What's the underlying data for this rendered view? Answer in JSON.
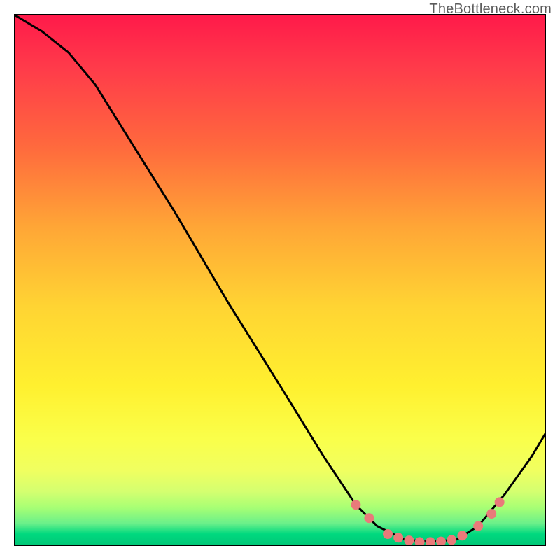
{
  "attribution": "TheBottleneck.com",
  "chart_data": {
    "type": "line",
    "title": "",
    "xlabel": "",
    "ylabel": "",
    "x_range": [
      0,
      1
    ],
    "y_range": [
      0,
      1
    ],
    "background_gradient": {
      "top": "#ff1a4a",
      "mid_high": "#ffd433",
      "mid_low": "#fff02f",
      "bottom": "#00c877"
    },
    "series": [
      {
        "name": "curve",
        "color": "#000000",
        "stroke_width": 3,
        "points": [
          {
            "x": 0.0,
            "y": 1.0
          },
          {
            "x": 0.05,
            "y": 0.97
          },
          {
            "x": 0.1,
            "y": 0.93
          },
          {
            "x": 0.15,
            "y": 0.87
          },
          {
            "x": 0.2,
            "y": 0.79
          },
          {
            "x": 0.3,
            "y": 0.63
          },
          {
            "x": 0.4,
            "y": 0.46
          },
          {
            "x": 0.5,
            "y": 0.3
          },
          {
            "x": 0.58,
            "y": 0.17
          },
          {
            "x": 0.64,
            "y": 0.08
          },
          {
            "x": 0.68,
            "y": 0.04
          },
          {
            "x": 0.73,
            "y": 0.015
          },
          {
            "x": 0.78,
            "y": 0.01
          },
          {
            "x": 0.83,
            "y": 0.015
          },
          {
            "x": 0.87,
            "y": 0.04
          },
          {
            "x": 0.92,
            "y": 0.1
          },
          {
            "x": 0.97,
            "y": 0.17
          },
          {
            "x": 1.0,
            "y": 0.22
          }
        ]
      },
      {
        "name": "markers",
        "color": "#e97a7a",
        "radius": 7,
        "points": [
          {
            "x": 0.64,
            "y": 0.08
          },
          {
            "x": 0.665,
            "y": 0.055
          },
          {
            "x": 0.7,
            "y": 0.025
          },
          {
            "x": 0.72,
            "y": 0.018
          },
          {
            "x": 0.74,
            "y": 0.013
          },
          {
            "x": 0.76,
            "y": 0.01
          },
          {
            "x": 0.78,
            "y": 0.01
          },
          {
            "x": 0.8,
            "y": 0.011
          },
          {
            "x": 0.82,
            "y": 0.014
          },
          {
            "x": 0.84,
            "y": 0.022
          },
          {
            "x": 0.87,
            "y": 0.04
          },
          {
            "x": 0.895,
            "y": 0.063
          },
          {
            "x": 0.91,
            "y": 0.085
          }
        ]
      }
    ]
  }
}
